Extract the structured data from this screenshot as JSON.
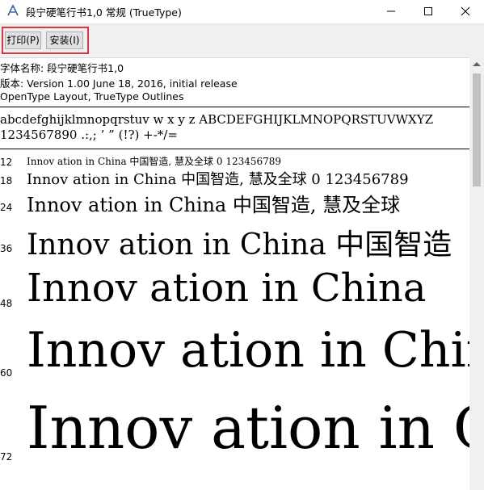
{
  "window": {
    "title": "段宁硬笔行书1,0 常规 (TrueType)",
    "minimize_glyph": "minimize-icon",
    "maximize_glyph": "maximize-icon",
    "close_glyph": "close-icon"
  },
  "toolbar": {
    "print_label": "打印(P)",
    "install_label": "安装(I)",
    "highlight_color": "#e0343f"
  },
  "font_info": {
    "name_line": "字体名称: 段宁硬笔行书1,0",
    "version_line": "版本: Version 1.00 June 18, 2016, initial release",
    "layout_line": "OpenType Layout, TrueType Outlines"
  },
  "charset": {
    "line1": "abcdefghijklmnopqrstuv w x y z    ABCDEFGHIJKLMNOPQRSTUVWXYZ",
    "line2": "1234567890 .:,;  ’  ” (!?)  +-*/="
  },
  "samples": [
    {
      "size": "12",
      "text": "Innov ation  in  China  中国智造, 慧及全球  0 123456789"
    },
    {
      "size": "18",
      "text": "Innov ation  in  China  中国智造, 慧及全球  0 123456789"
    },
    {
      "size": "24",
      "text": "Innov ation  in  China  中国智造, 慧及全球"
    },
    {
      "size": "36",
      "text": "Innov ation  in  China  中国智造"
    },
    {
      "size": "48",
      "text": "Innov ation  in  China"
    },
    {
      "size": "60",
      "text": "Innov ation  in  China"
    },
    {
      "size": "72",
      "text": "Innov ation  in  China"
    }
  ]
}
